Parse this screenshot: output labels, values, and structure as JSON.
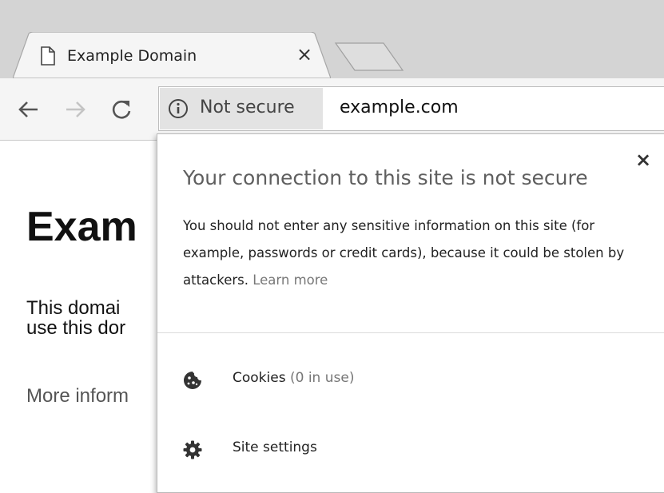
{
  "tab": {
    "title": "Example Domain",
    "close_glyph": "×",
    "favicon_icon": "page-icon"
  },
  "toolbar": {
    "back_icon": "arrow-left-icon",
    "forward_icon": "arrow-right-icon",
    "reload_icon": "reload-icon"
  },
  "omnibox": {
    "security_label": "Not secure",
    "security_icon": "info-icon",
    "url": "example.com"
  },
  "page": {
    "heading": "Exam",
    "para_line1": "This domai",
    "para_line2": "use this dor",
    "more": "More inform"
  },
  "bubble": {
    "close_glyph": "×",
    "title": "Your connection to this site is not secure",
    "body": "You should not enter any sensitive information on this site (for example, passwords or credit cards), because it could be stolen by attackers.",
    "learn_more": "Learn more",
    "cookies_label": "Cookies",
    "cookies_count": "(0 in use)",
    "cookies_icon": "cookie-icon",
    "site_settings_label": "Site settings",
    "site_settings_icon": "gear-icon"
  },
  "colors": {
    "tabstrip_bg": "#d4d4d4",
    "toolbar_bg": "#f5f5f5",
    "security_chip_bg": "#e3e3e3",
    "muted_text": "#777777"
  }
}
